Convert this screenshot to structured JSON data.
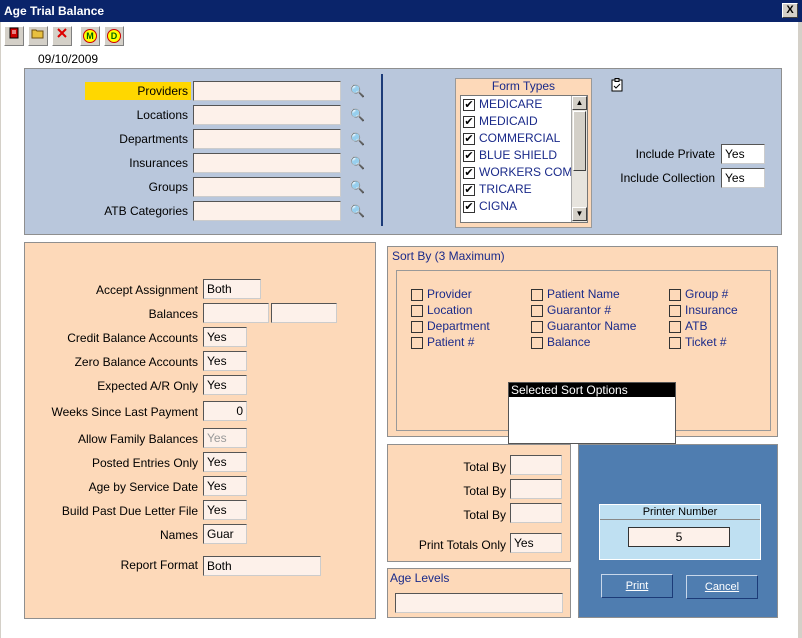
{
  "window": {
    "title": "Age Trial Balance",
    "close": "X"
  },
  "toolbar": {
    "icons": [
      "report-icon",
      "open-folder-icon",
      "delete-icon",
      "m-icon",
      "d-icon"
    ],
    "m_label": "M",
    "d_label": "D"
  },
  "date": "09/10/2009",
  "filters": [
    {
      "label": "Providers",
      "value": ""
    },
    {
      "label": "Locations",
      "value": ""
    },
    {
      "label": "Departments",
      "value": ""
    },
    {
      "label": "Insurances",
      "value": ""
    },
    {
      "label": "Groups",
      "value": ""
    },
    {
      "label": "ATB Categories",
      "value": ""
    }
  ],
  "form_types": {
    "title": "Form Types",
    "items": [
      {
        "label": "MEDICARE",
        "checked": true
      },
      {
        "label": "MEDICAID",
        "checked": true
      },
      {
        "label": "COMMERCIAL",
        "checked": true
      },
      {
        "label": "BLUE SHIELD",
        "checked": true
      },
      {
        "label": "WORKERS COM",
        "checked": true
      },
      {
        "label": "TRICARE",
        "checked": true
      },
      {
        "label": "CIGNA",
        "checked": true
      }
    ]
  },
  "include": {
    "private_label": "Include Private",
    "private_value": "Yes",
    "collection_label": "Include Collection",
    "collection_value": "Yes"
  },
  "options": [
    {
      "label": "Accept Assignment",
      "value": "Both"
    },
    {
      "label": "Balances",
      "value": "",
      "value2": ""
    },
    {
      "label": "Credit Balance Accounts",
      "value": "Yes"
    },
    {
      "label": "Zero Balance Accounts",
      "value": "Yes"
    },
    {
      "label": "Expected A/R Only",
      "value": "Yes"
    },
    {
      "label": "Weeks Since Last Payment",
      "value": "0"
    },
    {
      "label": "Allow Family Balances",
      "value": "Yes"
    },
    {
      "label": "Posted Entries Only",
      "value": "Yes"
    },
    {
      "label": "Age by Service Date",
      "value": "Yes"
    },
    {
      "label": "Build Past Due Letter File",
      "value": "Yes"
    },
    {
      "label": "Names",
      "value": "Guar"
    },
    {
      "label": "Report Format",
      "value": "Both"
    }
  ],
  "sort": {
    "title": "Sort By (3 Maximum)",
    "col1": [
      "Provider",
      "Location",
      "Department",
      "Patient #"
    ],
    "col2": [
      "Patient Name",
      "Guarantor #",
      "Guarantor Name",
      "Balance"
    ],
    "col3": [
      "Group #",
      "Insurance",
      "ATB",
      "Ticket #"
    ],
    "selected_title": "Selected Sort Options"
  },
  "totals": {
    "total_by_label": "Total By",
    "values": [
      "",
      "",
      ""
    ],
    "print_totals_label": "Print Totals Only",
    "print_totals_value": "Yes"
  },
  "age_levels": {
    "title": "Age Levels",
    "value": ""
  },
  "printer": {
    "title": "Printer Number",
    "value": "5",
    "print_label": "Print",
    "cancel_label": "Cancel"
  }
}
